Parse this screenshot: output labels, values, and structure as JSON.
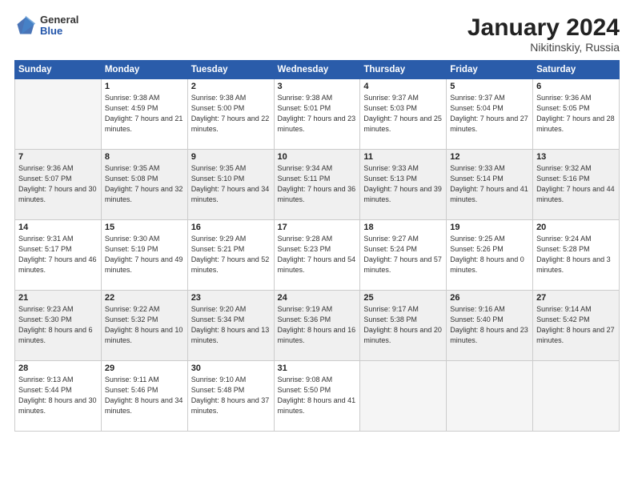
{
  "header": {
    "logo": {
      "general": "General",
      "blue": "Blue"
    },
    "title": "January 2024",
    "location": "Nikitinskiy, Russia"
  },
  "days_of_week": [
    "Sunday",
    "Monday",
    "Tuesday",
    "Wednesday",
    "Thursday",
    "Friday",
    "Saturday"
  ],
  "weeks": [
    {
      "shade": false,
      "days": [
        {
          "num": "",
          "empty": true
        },
        {
          "num": "1",
          "sunrise": "Sunrise: 9:38 AM",
          "sunset": "Sunset: 4:59 PM",
          "daylight": "Daylight: 7 hours and 21 minutes."
        },
        {
          "num": "2",
          "sunrise": "Sunrise: 9:38 AM",
          "sunset": "Sunset: 5:00 PM",
          "daylight": "Daylight: 7 hours and 22 minutes."
        },
        {
          "num": "3",
          "sunrise": "Sunrise: 9:38 AM",
          "sunset": "Sunset: 5:01 PM",
          "daylight": "Daylight: 7 hours and 23 minutes."
        },
        {
          "num": "4",
          "sunrise": "Sunrise: 9:37 AM",
          "sunset": "Sunset: 5:03 PM",
          "daylight": "Daylight: 7 hours and 25 minutes."
        },
        {
          "num": "5",
          "sunrise": "Sunrise: 9:37 AM",
          "sunset": "Sunset: 5:04 PM",
          "daylight": "Daylight: 7 hours and 27 minutes."
        },
        {
          "num": "6",
          "sunrise": "Sunrise: 9:36 AM",
          "sunset": "Sunset: 5:05 PM",
          "daylight": "Daylight: 7 hours and 28 minutes."
        }
      ]
    },
    {
      "shade": true,
      "days": [
        {
          "num": "7",
          "sunrise": "Sunrise: 9:36 AM",
          "sunset": "Sunset: 5:07 PM",
          "daylight": "Daylight: 7 hours and 30 minutes."
        },
        {
          "num": "8",
          "sunrise": "Sunrise: 9:35 AM",
          "sunset": "Sunset: 5:08 PM",
          "daylight": "Daylight: 7 hours and 32 minutes."
        },
        {
          "num": "9",
          "sunrise": "Sunrise: 9:35 AM",
          "sunset": "Sunset: 5:10 PM",
          "daylight": "Daylight: 7 hours and 34 minutes."
        },
        {
          "num": "10",
          "sunrise": "Sunrise: 9:34 AM",
          "sunset": "Sunset: 5:11 PM",
          "daylight": "Daylight: 7 hours and 36 minutes."
        },
        {
          "num": "11",
          "sunrise": "Sunrise: 9:33 AM",
          "sunset": "Sunset: 5:13 PM",
          "daylight": "Daylight: 7 hours and 39 minutes."
        },
        {
          "num": "12",
          "sunrise": "Sunrise: 9:33 AM",
          "sunset": "Sunset: 5:14 PM",
          "daylight": "Daylight: 7 hours and 41 minutes."
        },
        {
          "num": "13",
          "sunrise": "Sunrise: 9:32 AM",
          "sunset": "Sunset: 5:16 PM",
          "daylight": "Daylight: 7 hours and 44 minutes."
        }
      ]
    },
    {
      "shade": false,
      "days": [
        {
          "num": "14",
          "sunrise": "Sunrise: 9:31 AM",
          "sunset": "Sunset: 5:17 PM",
          "daylight": "Daylight: 7 hours and 46 minutes."
        },
        {
          "num": "15",
          "sunrise": "Sunrise: 9:30 AM",
          "sunset": "Sunset: 5:19 PM",
          "daylight": "Daylight: 7 hours and 49 minutes."
        },
        {
          "num": "16",
          "sunrise": "Sunrise: 9:29 AM",
          "sunset": "Sunset: 5:21 PM",
          "daylight": "Daylight: 7 hours and 52 minutes."
        },
        {
          "num": "17",
          "sunrise": "Sunrise: 9:28 AM",
          "sunset": "Sunset: 5:23 PM",
          "daylight": "Daylight: 7 hours and 54 minutes."
        },
        {
          "num": "18",
          "sunrise": "Sunrise: 9:27 AM",
          "sunset": "Sunset: 5:24 PM",
          "daylight": "Daylight: 7 hours and 57 minutes."
        },
        {
          "num": "19",
          "sunrise": "Sunrise: 9:25 AM",
          "sunset": "Sunset: 5:26 PM",
          "daylight": "Daylight: 8 hours and 0 minutes."
        },
        {
          "num": "20",
          "sunrise": "Sunrise: 9:24 AM",
          "sunset": "Sunset: 5:28 PM",
          "daylight": "Daylight: 8 hours and 3 minutes."
        }
      ]
    },
    {
      "shade": true,
      "days": [
        {
          "num": "21",
          "sunrise": "Sunrise: 9:23 AM",
          "sunset": "Sunset: 5:30 PM",
          "daylight": "Daylight: 8 hours and 6 minutes."
        },
        {
          "num": "22",
          "sunrise": "Sunrise: 9:22 AM",
          "sunset": "Sunset: 5:32 PM",
          "daylight": "Daylight: 8 hours and 10 minutes."
        },
        {
          "num": "23",
          "sunrise": "Sunrise: 9:20 AM",
          "sunset": "Sunset: 5:34 PM",
          "daylight": "Daylight: 8 hours and 13 minutes."
        },
        {
          "num": "24",
          "sunrise": "Sunrise: 9:19 AM",
          "sunset": "Sunset: 5:36 PM",
          "daylight": "Daylight: 8 hours and 16 minutes."
        },
        {
          "num": "25",
          "sunrise": "Sunrise: 9:17 AM",
          "sunset": "Sunset: 5:38 PM",
          "daylight": "Daylight: 8 hours and 20 minutes."
        },
        {
          "num": "26",
          "sunrise": "Sunrise: 9:16 AM",
          "sunset": "Sunset: 5:40 PM",
          "daylight": "Daylight: 8 hours and 23 minutes."
        },
        {
          "num": "27",
          "sunrise": "Sunrise: 9:14 AM",
          "sunset": "Sunset: 5:42 PM",
          "daylight": "Daylight: 8 hours and 27 minutes."
        }
      ]
    },
    {
      "shade": false,
      "days": [
        {
          "num": "28",
          "sunrise": "Sunrise: 9:13 AM",
          "sunset": "Sunset: 5:44 PM",
          "daylight": "Daylight: 8 hours and 30 minutes."
        },
        {
          "num": "29",
          "sunrise": "Sunrise: 9:11 AM",
          "sunset": "Sunset: 5:46 PM",
          "daylight": "Daylight: 8 hours and 34 minutes."
        },
        {
          "num": "30",
          "sunrise": "Sunrise: 9:10 AM",
          "sunset": "Sunset: 5:48 PM",
          "daylight": "Daylight: 8 hours and 37 minutes."
        },
        {
          "num": "31",
          "sunrise": "Sunrise: 9:08 AM",
          "sunset": "Sunset: 5:50 PM",
          "daylight": "Daylight: 8 hours and 41 minutes."
        },
        {
          "num": "",
          "empty": true
        },
        {
          "num": "",
          "empty": true
        },
        {
          "num": "",
          "empty": true
        }
      ]
    }
  ]
}
